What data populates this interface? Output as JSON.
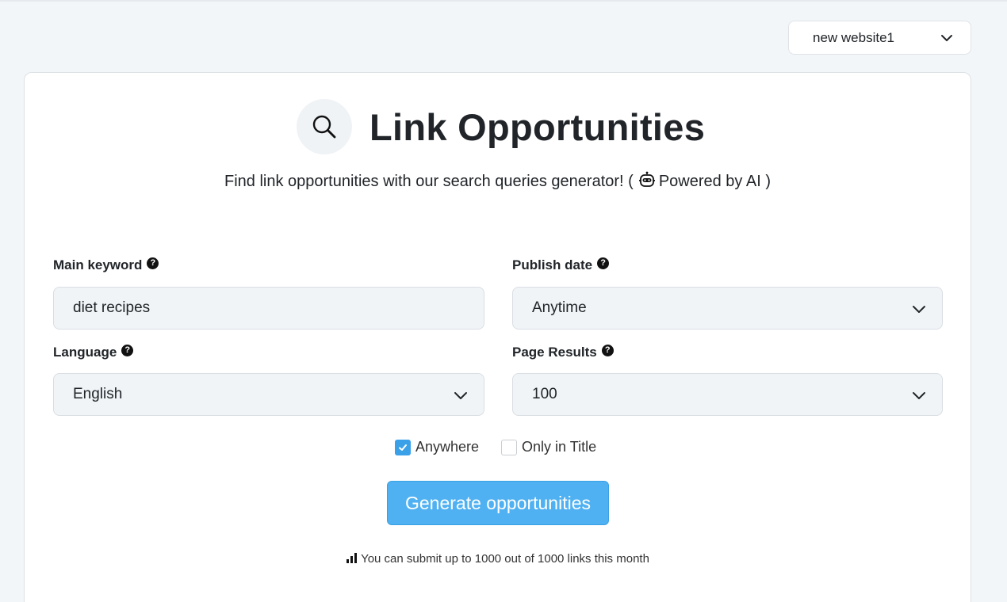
{
  "website_select": {
    "value": "new website1"
  },
  "header": {
    "title": "Link Opportunities",
    "subtitle_prefix": "Find link opportunities with our search queries generator! (",
    "subtitle_suffix": "Powered by AI )"
  },
  "form": {
    "main_keyword": {
      "label": "Main keyword",
      "value": "diet recipes"
    },
    "publish_date": {
      "label": "Publish date",
      "value": "Anytime"
    },
    "language": {
      "label": "Language",
      "value": "English"
    },
    "page_results": {
      "label": "Page Results",
      "value": "100"
    },
    "help_glyph": "?"
  },
  "options": {
    "anywhere": {
      "label": "Anywhere",
      "checked": true
    },
    "only_in_title": {
      "label": "Only in Title",
      "checked": false
    }
  },
  "generate_button": {
    "label": "Generate opportunities"
  },
  "quota": {
    "text": "You can submit up to 1000 out of 1000 links this month"
  },
  "colors": {
    "accent": "#4fb1f1",
    "checkbox": "#3aa0e8",
    "field_bg": "#f1f4f7",
    "page_bg": "#f3f6f9"
  },
  "icons": [
    "chevron-down-icon",
    "search-icon",
    "robot-icon",
    "help-icon",
    "check-icon",
    "bar-chart-icon"
  ]
}
